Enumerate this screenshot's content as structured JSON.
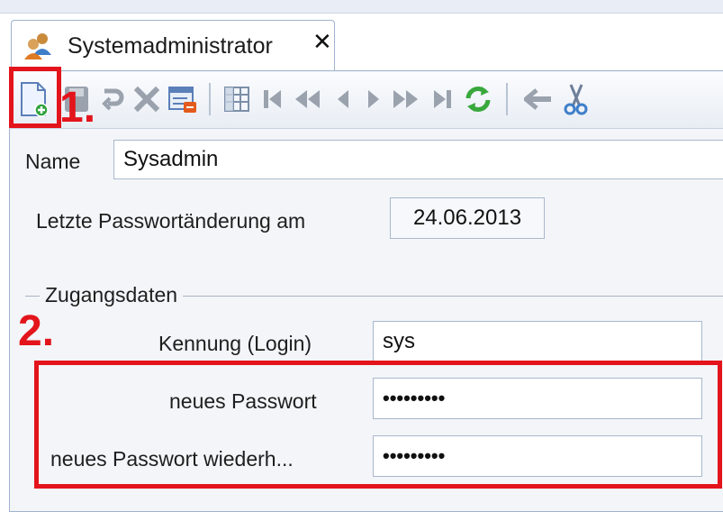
{
  "tab": {
    "title": "Systemadministrator",
    "close_glyph": "✕",
    "icon": "users-icon"
  },
  "toolbar": {
    "buttons": [
      {
        "name": "new-record-button",
        "icon": "new-document-icon"
      },
      {
        "name": "save-button",
        "icon": "save-icon"
      },
      {
        "name": "undo-button",
        "icon": "undo-icon"
      },
      {
        "name": "delete-button",
        "icon": "delete-icon"
      },
      {
        "name": "form-button",
        "icon": "form-icon"
      },
      {
        "name": "table-view-button",
        "icon": "table-icon"
      },
      {
        "name": "first-record-button",
        "icon": "first-icon"
      },
      {
        "name": "fast-back-button",
        "icon": "fast-back-icon"
      },
      {
        "name": "previous-record-button",
        "icon": "prev-icon"
      },
      {
        "name": "next-record-button",
        "icon": "next-icon"
      },
      {
        "name": "fast-forward-button",
        "icon": "fast-forward-icon"
      },
      {
        "name": "last-record-button",
        "icon": "last-icon"
      },
      {
        "name": "refresh-button",
        "icon": "refresh-icon"
      },
      {
        "name": "back-button",
        "icon": "arrow-left-icon"
      },
      {
        "name": "cut-button",
        "icon": "scissors-icon"
      }
    ]
  },
  "annotations": {
    "step1": "1.",
    "step2": "2.",
    "color": "#e3141b"
  },
  "form": {
    "name_label": "Name",
    "name_value": "Sysadmin",
    "last_change_label": "Letzte Passwortänderung am",
    "last_change_value": "24.06.2013",
    "group_title": "Zugangsdaten",
    "login_label": "Kennung (Login)",
    "login_value": "sys",
    "new_password_label": "neues Passwort",
    "new_password_value": "•••••••••",
    "repeat_password_label": "neues Passwort wiederh...",
    "repeat_password_value": "•••••••••"
  }
}
